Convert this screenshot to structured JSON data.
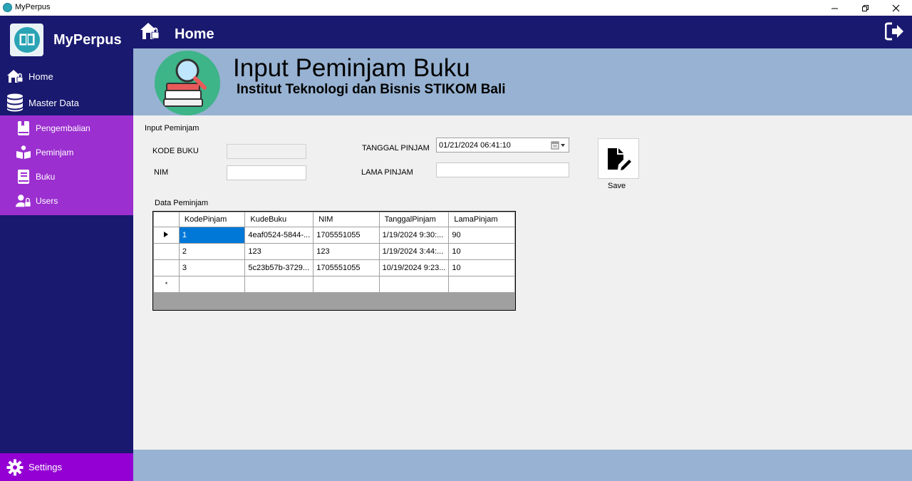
{
  "window": {
    "title": "MyPerpus"
  },
  "sidebar": {
    "logo_text": "MyPerpus",
    "items": [
      {
        "label": "Home",
        "icon": "home-lock-icon"
      },
      {
        "label": "Master Data",
        "icon": "database-icon"
      }
    ],
    "submenu": [
      {
        "label": "Pengembalian",
        "icon": "book-bookmark-icon"
      },
      {
        "label": "Peminjam",
        "icon": "reader-book-icon"
      },
      {
        "label": "Buku",
        "icon": "book-icon"
      },
      {
        "label": "Users",
        "icon": "user-lock-icon"
      }
    ],
    "settings_label": "Settings"
  },
  "header": {
    "title": "Home"
  },
  "banner": {
    "title": "Input Peminjam Buku",
    "subtitle": "Institut Teknologi dan Bisnis STIKOM Bali"
  },
  "form": {
    "group_label": "Input Peminjam",
    "kode_buku_label": "KODE BUKU",
    "kode_buku_value": "",
    "nim_label": "NIM",
    "nim_value": "",
    "tanggal_label": "TANGGAL PINJAM",
    "tanggal_value": "01/21/2024 06:41:10",
    "lama_label": "LAMA PINJAM",
    "lama_value": "",
    "save_label": "Save"
  },
  "table": {
    "caption": "Data Peminjam",
    "columns": [
      "KodePinjam",
      "KudeBuku",
      "NIM",
      "TanggalPinjam",
      "LamaPinjam"
    ],
    "rows": [
      [
        "1",
        "4eaf0524-5844-...",
        "1705551055",
        "1/19/2024 9:30:...",
        "90"
      ],
      [
        "2",
        "123",
        "123",
        "1/19/2024 3:44:...",
        "10"
      ],
      [
        "3",
        "5c23b57b-3729...",
        "1705551055",
        "10/19/2024 9:23...",
        "10"
      ]
    ],
    "new_row_marker": "*"
  },
  "colors": {
    "sidebar_bg": "#191970",
    "submenu_bg": "#9b2fcf",
    "settings_bg": "#9400d3",
    "banner_bg": "#97b2d2",
    "content_bg": "#f0f0f0",
    "selection": "#0078d7"
  }
}
